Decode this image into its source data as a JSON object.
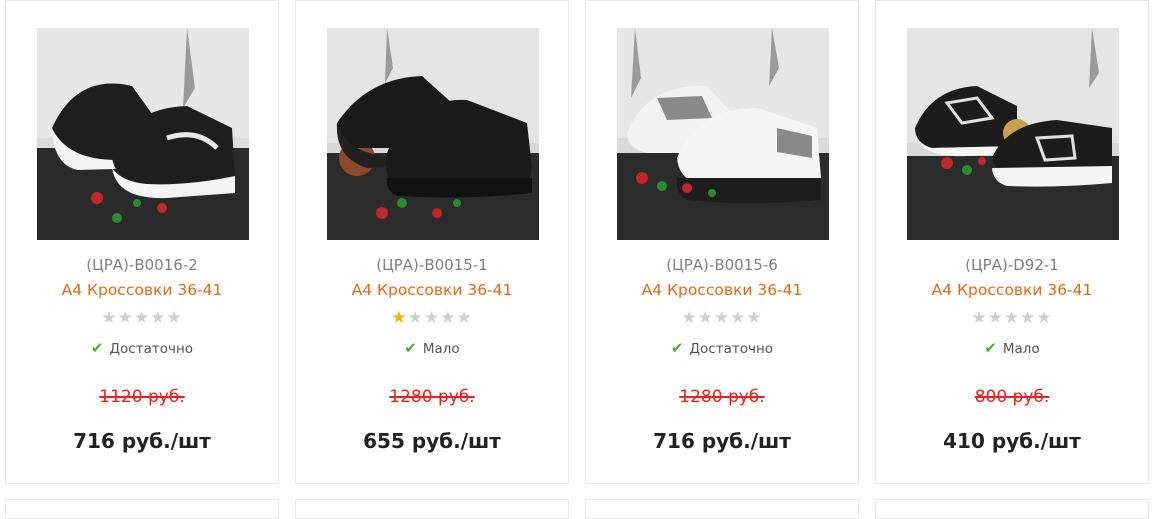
{
  "products": [
    {
      "sku": "(ЦРА)-B0016-2",
      "name": "А4 Кроссовки 36-41",
      "rating": 0,
      "stock": "Достаточно",
      "old_price": "1120 руб.",
      "price": "716 руб./шт",
      "shoe_colors": {
        "upper": "#1e1e1e",
        "sole": "#f4f4f4",
        "accent": "#e8e8e8"
      }
    },
    {
      "sku": "(ЦРА)-B0015-1",
      "name": "А4 Кроссовки 36-41",
      "rating": 1,
      "stock": "Мало",
      "old_price": "1280 руб.",
      "price": "655 руб./шт",
      "shoe_colors": {
        "upper": "#1a1a1a",
        "sole": "#222222",
        "accent": "#333333"
      }
    },
    {
      "sku": "(ЦРА)-B0015-6",
      "name": "А4 Кроссовки 36-41",
      "rating": 0,
      "stock": "Достаточно",
      "old_price": "1280 руб.",
      "price": "716 руб./шт",
      "shoe_colors": {
        "upper": "#f2f2f2",
        "sole": "#ffffff",
        "accent": "#8a8a8a"
      }
    },
    {
      "sku": "(ЦРА)-D92-1",
      "name": "А4 Кроссовки 36-41",
      "rating": 0,
      "stock": "Мало",
      "old_price": "800 руб.",
      "price": "410 руб./шт",
      "shoe_colors": {
        "upper": "#1c1c1c",
        "sole": "#f5f5f5",
        "accent": "#e0e0e0"
      }
    }
  ],
  "icons": {
    "star": "star-icon",
    "check": "check-icon"
  },
  "colors": {
    "name": "#e06a1a",
    "old_price": "#e8231e",
    "check": "#4caf2c",
    "star_on": "#f2b600",
    "star_off": "#cfcfcf"
  }
}
